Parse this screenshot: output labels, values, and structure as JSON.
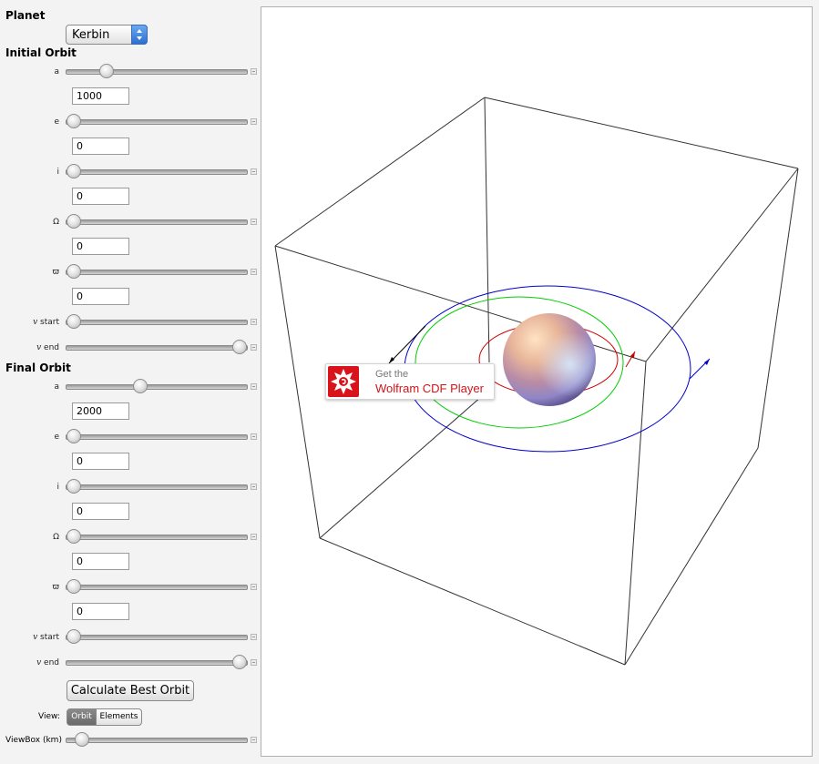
{
  "planet": {
    "label": "Planet",
    "selected": "Kerbin"
  },
  "initial": {
    "title": "Initial Orbit",
    "a": {
      "label": "a",
      "value": "1000",
      "slider": 0.2
    },
    "e": {
      "label": "e",
      "value": "0",
      "slider": 0.0
    },
    "i": {
      "label": "i",
      "value": "0",
      "slider": 0.0
    },
    "Omega": {
      "label": "Ω",
      "value": "0",
      "slider": 0.0
    },
    "w": {
      "label": "ϖ",
      "value": "0",
      "slider": 0.0
    },
    "v_start": {
      "label": "v",
      "suffix": " start",
      "slider": 0.0
    },
    "v_end": {
      "label": "v",
      "suffix": " end",
      "slider": 1.0
    }
  },
  "final": {
    "title": "Final Orbit",
    "a": {
      "label": "a",
      "value": "2000",
      "slider": 0.4
    },
    "e": {
      "label": "e",
      "value": "0",
      "slider": 0.0
    },
    "i": {
      "label": "i",
      "value": "0",
      "slider": 0.0
    },
    "Omega": {
      "label": "Ω",
      "value": "0",
      "slider": 0.0
    },
    "w": {
      "label": "ϖ",
      "value": "0",
      "slider": 0.0
    },
    "v_start": {
      "label": "v",
      "suffix": " start",
      "slider": 0.0
    },
    "v_end": {
      "label": "v",
      "suffix": " end",
      "slider": 1.0
    }
  },
  "calculate_button": "Calculate Best Orbit",
  "view": {
    "label": "View:",
    "options": [
      "Orbit",
      "Elements"
    ],
    "selected": "Orbit"
  },
  "viewbox": {
    "label": "ViewBox (km)",
    "slider": 0.05
  },
  "cdf_badge": {
    "line1": "Get the",
    "line2": "Wolfram CDF Player"
  },
  "colors": {
    "initial_orbit": "#cc0000",
    "final_orbit": "#0000cc",
    "transfer_orbit": "#00cc00",
    "planet_highlight": "#ffe3c4",
    "planet_shadow": "#3a2a66",
    "cdf_red": "#d8131b"
  }
}
